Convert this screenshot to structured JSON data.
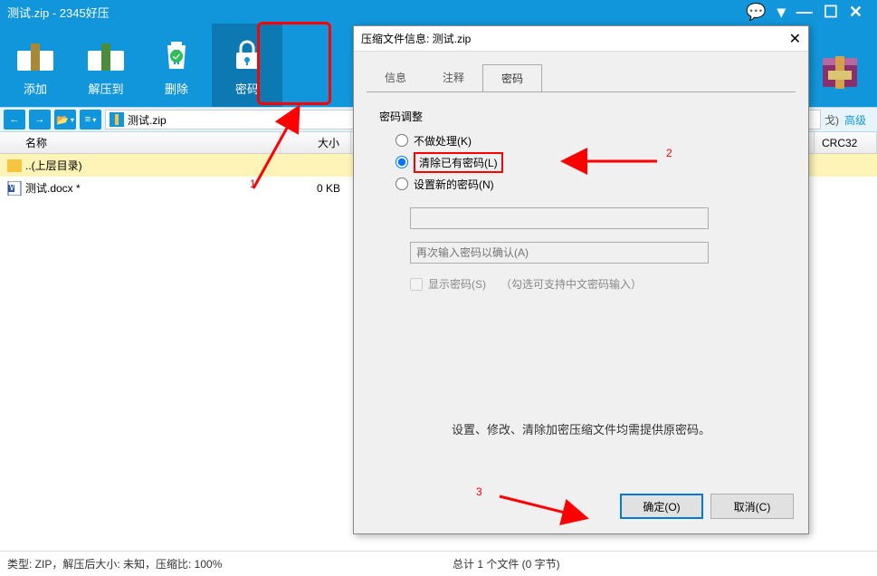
{
  "titlebar": {
    "title": "测试.zip - 2345好压"
  },
  "toolbar": {
    "add": "添加",
    "extract": "解压到",
    "delete": "删除",
    "password": "密码"
  },
  "path": {
    "filename": "测试.zip"
  },
  "columns": {
    "name": "名称",
    "size": "大小",
    "crc": "CRC32"
  },
  "files": [
    {
      "name": "..(上层目录)",
      "size": "",
      "type": "folder"
    },
    {
      "name": "测试.docx *",
      "size": "0 KB",
      "type": "docx"
    }
  ],
  "right_label": "戈)",
  "adv_label": "高级",
  "status": {
    "left": "类型: ZIP，解压后大小: 未知，压缩比: 100%",
    "right": "总计 1 个文件 (0 字节)"
  },
  "dialog": {
    "title": "压缩文件信息: 测试.zip",
    "tabs": {
      "info": "信息",
      "comment": "注释",
      "password": "密码"
    },
    "fieldset": "密码调整",
    "radio_none": "不做处理(K)",
    "radio_clear": "清除已有密码(L)",
    "radio_set": "设置新的密码(N)",
    "confirm_placeholder": "再次输入密码以确认(A)",
    "show_pwd": "显示密码(S)",
    "show_pwd_hint": "（勾选可支持中文密码输入）",
    "help": "设置、修改、清除加密压缩文件均需提供原密码。",
    "ok": "确定(O)",
    "cancel": "取消(C)"
  },
  "annotations": {
    "n1": "1",
    "n2": "2",
    "n3": "3"
  }
}
